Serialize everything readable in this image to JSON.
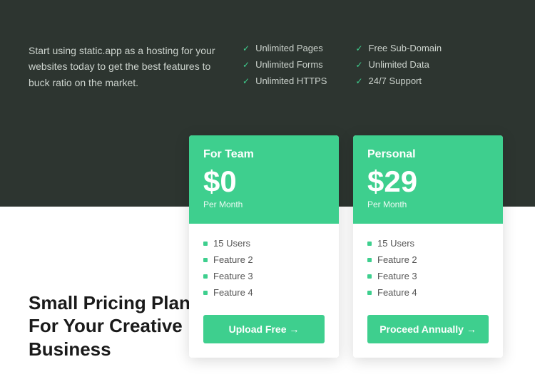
{
  "top": {
    "intro": "Start using static.app as a hosting for your websites today to get the best features to buck ratio on the market.",
    "features_col1": [
      "Unlimited Pages",
      "Unlimited Forms",
      "Unlimited HTTPS"
    ],
    "features_col2": [
      "Free Sub-Domain",
      "Unlimited Data",
      "24/7 Support"
    ]
  },
  "cards": [
    {
      "id": "team",
      "title": "For Team",
      "price": "$0",
      "period": "Per Month",
      "features": [
        "15 Users",
        "Feature 2",
        "Feature 3",
        "Feature 4"
      ],
      "cta": "Upload Free →"
    },
    {
      "id": "personal",
      "title": "Personal",
      "price": "$29",
      "period": "Per Month",
      "features": [
        "15 Users",
        "Feature 2",
        "Feature 3",
        "Feature 4"
      ],
      "cta": "Proceed Annually →"
    }
  ],
  "bottom": {
    "headline_line1": "Small Pricing Plan",
    "headline_line2": "For Your Creative",
    "headline_line3": "Business"
  },
  "colors": {
    "green": "#3ecf8e",
    "dark_bg": "#2d3530",
    "text_light": "#cdd4ce"
  }
}
